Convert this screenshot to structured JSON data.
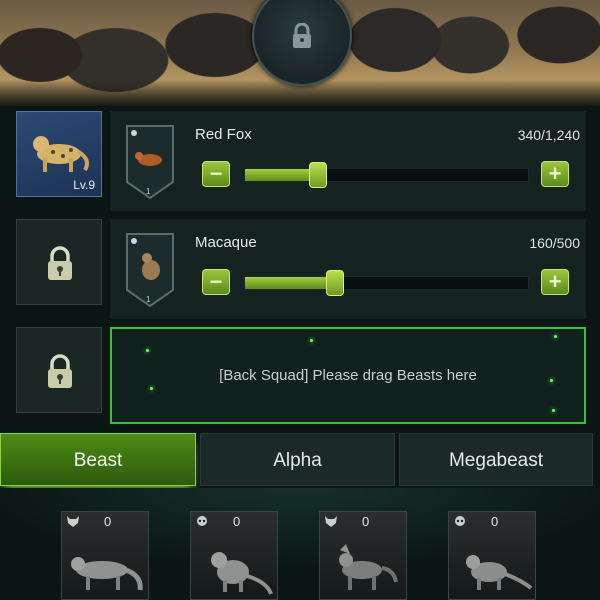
{
  "squad": {
    "leader_level": "Lv.9",
    "rows": [
      {
        "name": "Red Fox",
        "count": "340/1,240",
        "progress": 0.26
      },
      {
        "name": "Macaque",
        "count": "160/500",
        "progress": 0.32
      }
    ],
    "drop_hint": "[Back Squad] Please drag Beasts here",
    "shield_numbers": [
      "1",
      "1"
    ]
  },
  "buttons": {
    "minus": "−",
    "plus": "+"
  },
  "tabs": [
    {
      "label": "Beast",
      "active": true
    },
    {
      "label": "Alpha",
      "active": false
    },
    {
      "label": "Megabeast",
      "active": false
    }
  ],
  "beast_cards": [
    {
      "icon": "wolf-icon",
      "count": "0"
    },
    {
      "icon": "monkey-icon",
      "count": "0"
    },
    {
      "icon": "wolf-icon",
      "count": "0"
    },
    {
      "icon": "monkey-icon",
      "count": "0"
    }
  ],
  "colors": {
    "accent_green": "#8ed23a",
    "drop_border": "#36c23a",
    "leader_slot": "#2c4a72"
  }
}
